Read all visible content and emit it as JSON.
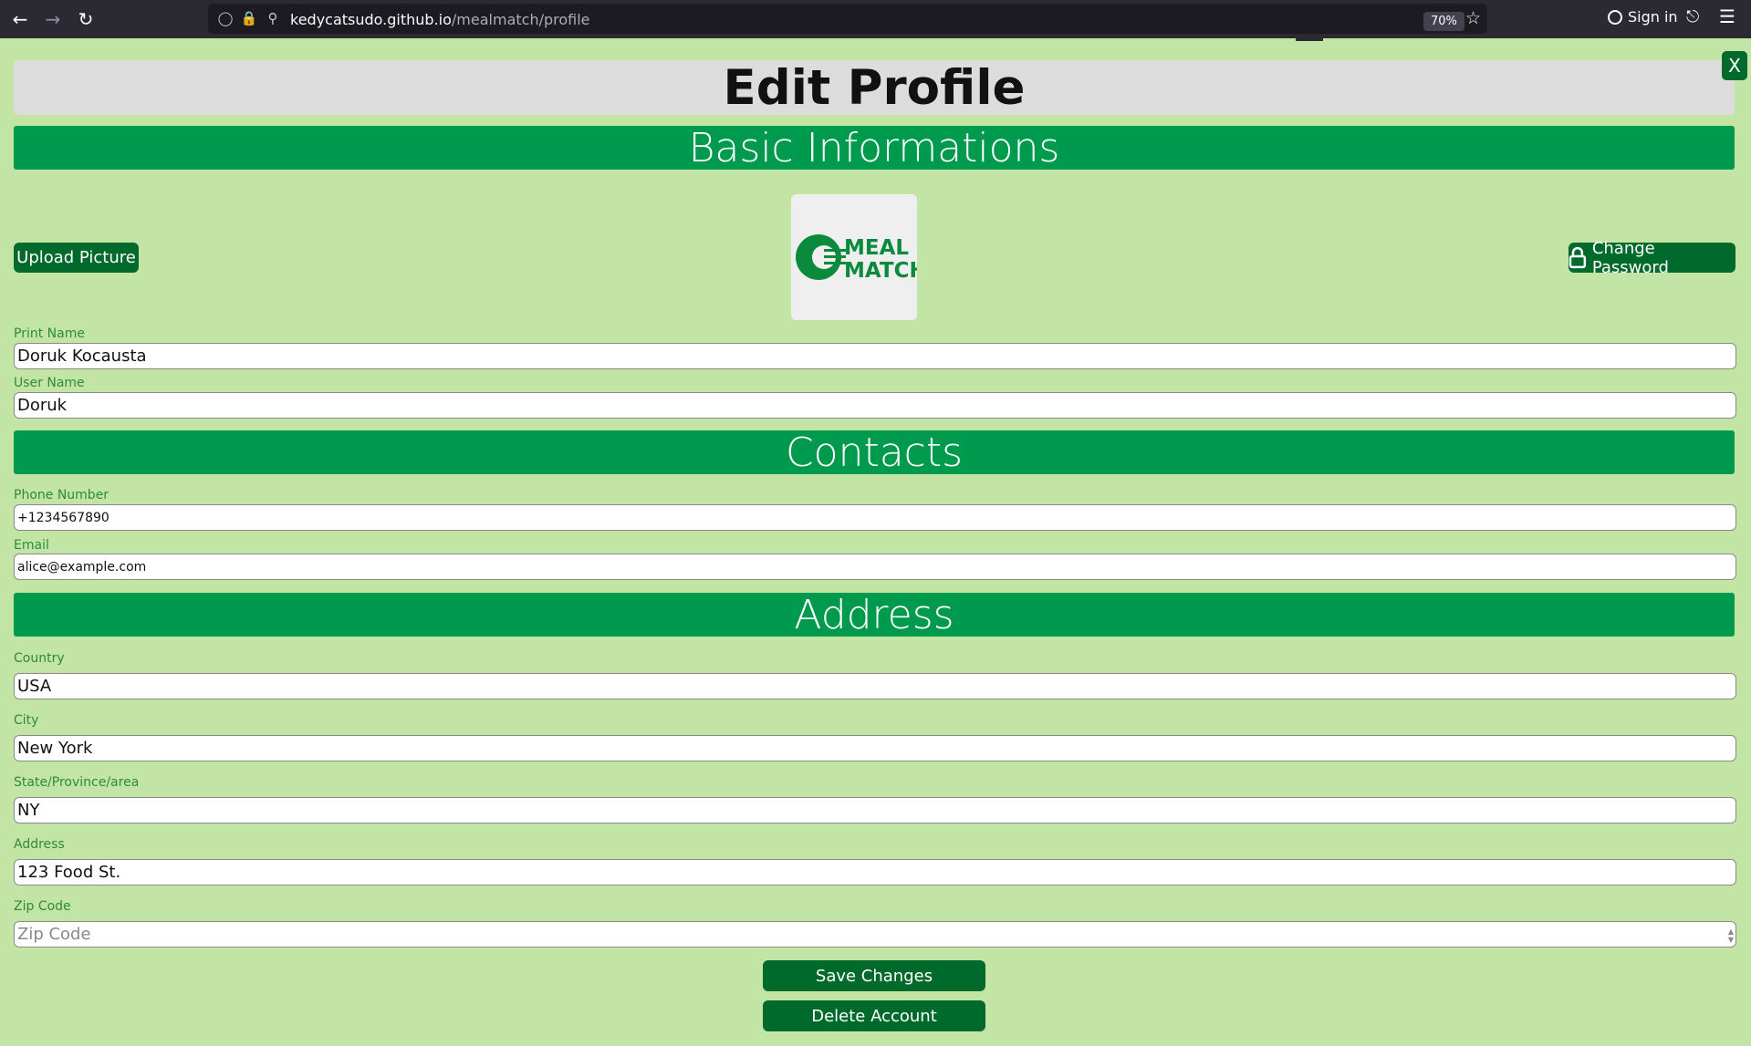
{
  "browser": {
    "url_host": "kedycatsudo.github.io",
    "url_path": "/mealmatch/profile",
    "zoom": "70%",
    "signin_label": "Sign in"
  },
  "page": {
    "title": "Edit Profile",
    "close_label": "X"
  },
  "sections": {
    "basic": "Basic Informations",
    "contacts": "Contacts",
    "address": "Address"
  },
  "buttons": {
    "upload_picture": "Upload Picture",
    "change_password": "Change Password",
    "save_changes": "Save Changes",
    "delete_account": "Delete Account"
  },
  "logo": {
    "line1": "MEAL",
    "line2": "MATCH"
  },
  "fields": {
    "print_name": {
      "label": "Print Name",
      "value": "Doruk Kocausta"
    },
    "user_name": {
      "label": "User Name",
      "value": "Doruk"
    },
    "phone": {
      "label": "Phone Number",
      "value": "+1234567890"
    },
    "email": {
      "label": "Email",
      "value": "alice@example.com"
    },
    "country": {
      "label": "Country",
      "value": "USA"
    },
    "city": {
      "label": "City",
      "value": "New York"
    },
    "state": {
      "label": "State/Province/area",
      "value": "NY"
    },
    "address": {
      "label": "Address",
      "value": "123 Food St."
    },
    "zip": {
      "label": "Zip Code",
      "value": "",
      "placeholder": "Zip Code"
    }
  },
  "colors": {
    "page_bg": "#c2e4a4",
    "section_bar": "#009a4e",
    "button": "#006a2c",
    "label": "#2e8b3a"
  }
}
